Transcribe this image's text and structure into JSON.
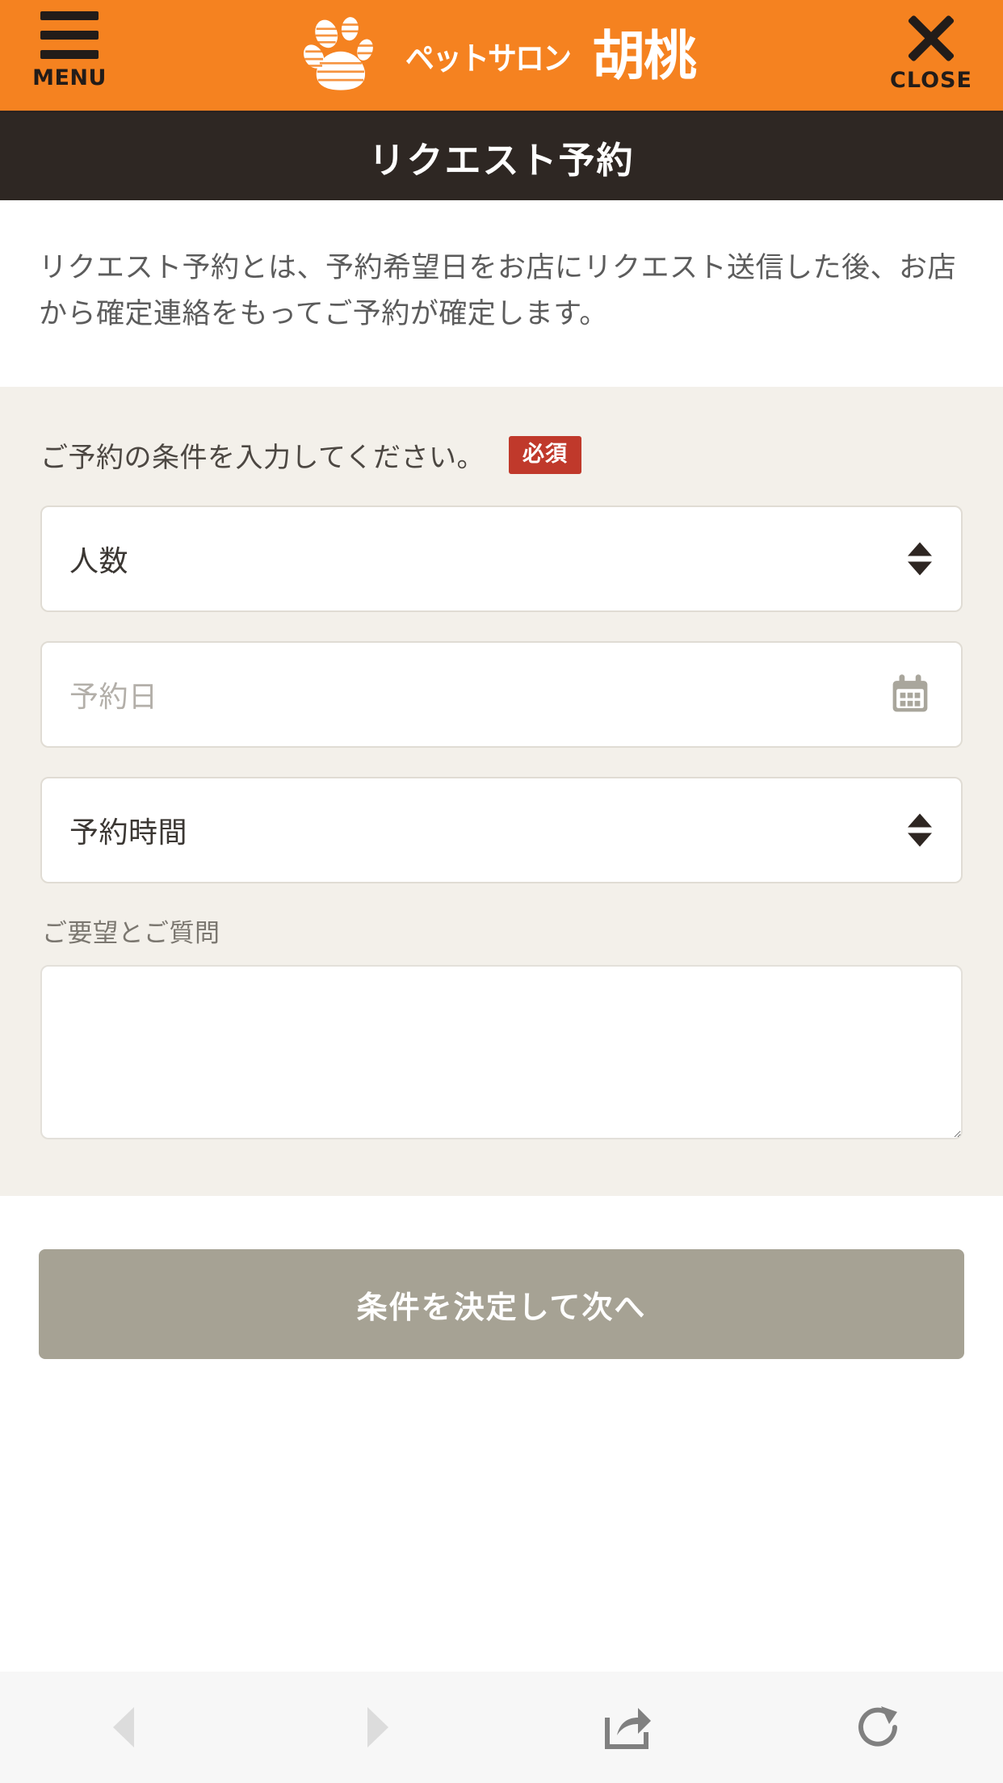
{
  "header": {
    "menu": {
      "label": "MENU",
      "icon": "hamburger-icon"
    },
    "close": {
      "label": "CLOSE",
      "icon": "close-x-icon"
    },
    "brand": {
      "logo_icon": "paw-print-icon",
      "subtitle": "ペットサロン",
      "name": "胡桃"
    },
    "background_color": "#f58220"
  },
  "titlebar": {
    "title": "リクエスト予約",
    "background_color": "#2e2723"
  },
  "intro": {
    "description": "リクエスト予約とは、予約希望日をお店にリクエスト送信した後、お店から確定連絡をもってご予約が確定します。"
  },
  "form": {
    "heading": "ご予約の条件を入力してください。",
    "required_badge": "必須",
    "required_badge_color": "#c0392b",
    "background_color": "#f3f0ea",
    "fields": [
      {
        "name": "people-count",
        "value": "人数",
        "control": "select",
        "icon": "stepper-arrows-icon"
      },
      {
        "name": "reservation-date",
        "value": "予約日",
        "control": "date",
        "is_placeholder": true,
        "icon": "calendar-icon"
      },
      {
        "name": "reservation-time",
        "value": "予約時間",
        "control": "select",
        "icon": "stepper-arrows-icon"
      }
    ],
    "textarea": {
      "label": "ご要望とご質問",
      "value": "",
      "placeholder": ""
    }
  },
  "submit": {
    "label": "条件を決定して次へ",
    "background_color": "#a6a294"
  },
  "browser_toolbar": {
    "background_color": "#f7f7f7",
    "buttons": [
      {
        "name": "back-icon",
        "state": "disabled"
      },
      {
        "name": "forward-icon",
        "state": "disabled"
      },
      {
        "name": "share-icon",
        "state": "enabled"
      },
      {
        "name": "reload-icon",
        "state": "enabled"
      }
    ]
  }
}
